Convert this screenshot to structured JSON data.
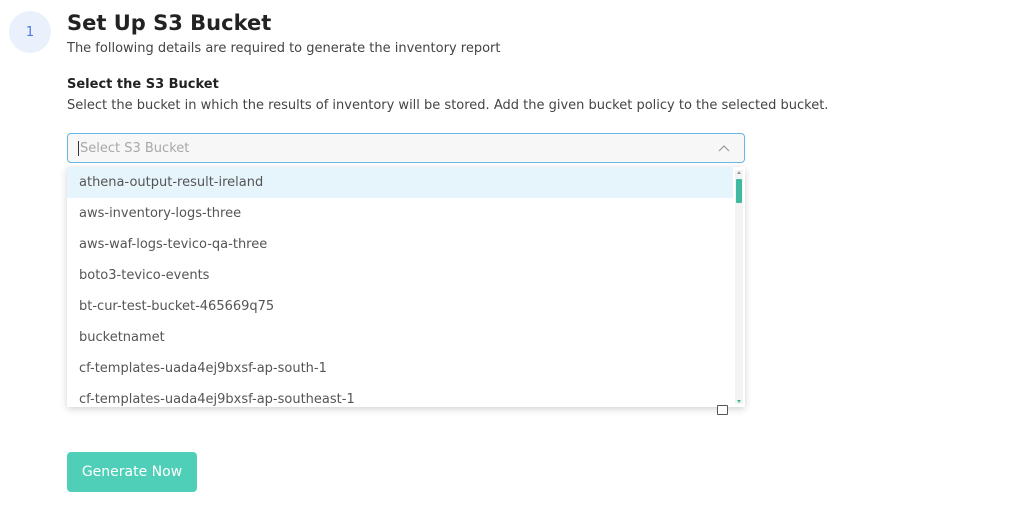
{
  "step": {
    "number": "1"
  },
  "header": {
    "title": "Set Up S3 Bucket",
    "subtitle": "The following details are required to generate the inventory report"
  },
  "section": {
    "label": "Select the S3 Bucket",
    "description": "Select the bucket in which the results of inventory will be stored. Add the given bucket policy to the selected bucket."
  },
  "select": {
    "placeholder": "Select S3 Bucket",
    "value": "",
    "open": true,
    "icon": "chevron-up-icon"
  },
  "dropdown": {
    "highlighted_index": 0,
    "options": [
      "athena-output-result-ireland",
      "aws-inventory-logs-three",
      "aws-waf-logs-tevico-qa-three",
      "boto3-tevico-events",
      "bt-cur-test-bucket-465669q75",
      "bucketnamet",
      "cf-templates-uada4ej9bxsf-ap-south-1",
      "cf-templates-uada4ej9bxsf-ap-southeast-1"
    ]
  },
  "actions": {
    "generate_label": "Generate Now"
  },
  "colors": {
    "accent": "#4fcfb8",
    "scrollbar_thumb": "#3fb9a0",
    "select_border": "#69b7e4",
    "highlight": "#e6f4fb",
    "step_circle_bg": "#eaf1fd"
  }
}
